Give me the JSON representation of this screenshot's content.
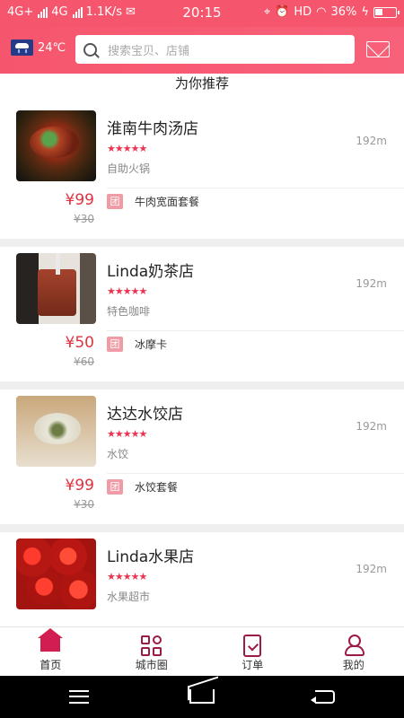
{
  "status_bar": {
    "network_left": "4G+",
    "network_right": "4G",
    "speed": "1.1K/s",
    "time": "20:15",
    "hd": "HD",
    "battery": "36%"
  },
  "header": {
    "weather": "24℃",
    "search_placeholder": "搜索宝贝、店铺",
    "icons": [
      "weather-icon",
      "search-icon",
      "mail-icon"
    ],
    "accent_color": "#f6566d"
  },
  "main": {
    "section_title": "为你推荐",
    "stores": [
      {
        "name": "淮南牛肉汤店",
        "rating": "★★★★★",
        "category": "自助火锅",
        "distance": "192m",
        "price": "¥99",
        "original_price": "¥30",
        "badge": "团",
        "deal": "牛肉宽面套餐"
      },
      {
        "name": "Linda奶茶店",
        "rating": "★★★★★",
        "category": "特色咖啡",
        "distance": "192m",
        "price": "¥50",
        "original_price": "¥60",
        "badge": "团",
        "deal": "冰摩卡"
      },
      {
        "name": "达达水饺店",
        "rating": "★★★★★",
        "category": "水饺",
        "distance": "192m",
        "price": "¥99",
        "original_price": "¥30",
        "badge": "团",
        "deal": "水饺套餐"
      },
      {
        "name": "Linda水果店",
        "rating": "★★★★★",
        "category": "水果超市",
        "distance": "192m"
      }
    ]
  },
  "tabbar": {
    "items": [
      {
        "label": "首页",
        "icon": "home-icon"
      },
      {
        "label": "城市圈",
        "icon": "city-circle-icon"
      },
      {
        "label": "订单",
        "icon": "order-icon"
      },
      {
        "label": "我的",
        "icon": "profile-icon"
      }
    ],
    "active_color": "#d11e51"
  },
  "system_nav": {
    "icons": [
      "menu-icon",
      "home-icon",
      "back-icon"
    ]
  }
}
